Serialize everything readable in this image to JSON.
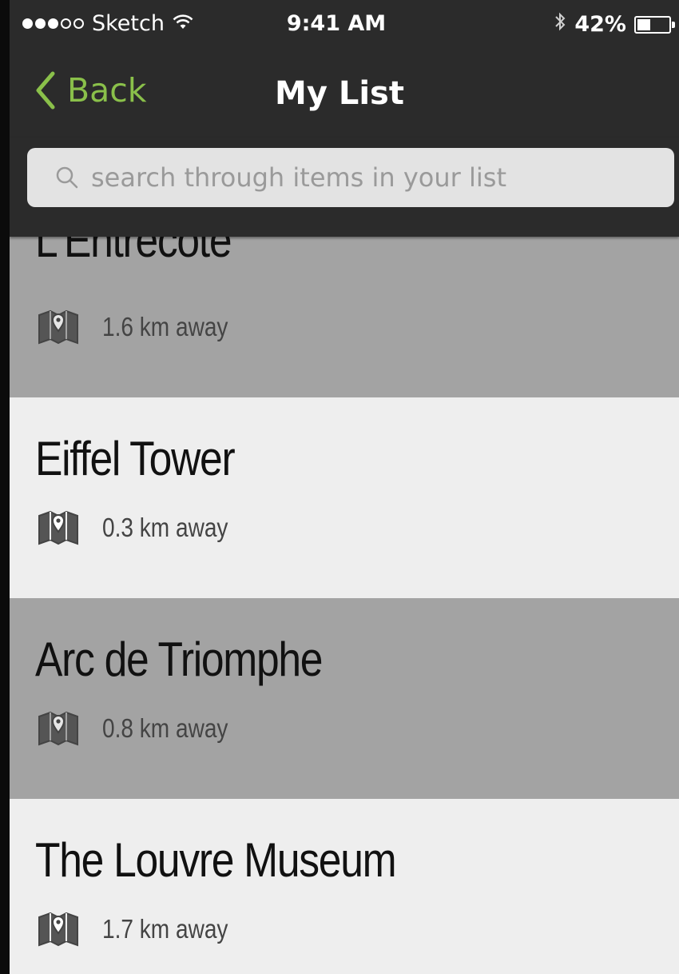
{
  "status_bar": {
    "carrier": "Sketch",
    "time": "9:41 AM",
    "battery_text": "42%",
    "battery_level": 0.42,
    "signal_bars_filled": 3,
    "signal_bars_total": 5,
    "wifi_icon": "wifi-icon",
    "bluetooth_icon": "bluetooth-icon"
  },
  "nav": {
    "back_label": "Back",
    "title": "My List",
    "accent_color": "#8ac04a"
  },
  "search": {
    "placeholder": "search through items in your list",
    "value": ""
  },
  "list": {
    "items": [
      {
        "title": "L'Entrecote",
        "distance": "1.6 km away",
        "icon": "map-pin-icon"
      },
      {
        "title": "Eiffel Tower",
        "distance": "0.3 km away",
        "icon": "map-pin-icon"
      },
      {
        "title": "Arc de Triomphe",
        "distance": "0.8 km away",
        "icon": "map-pin-icon"
      },
      {
        "title": "The Louvre Museum",
        "distance": "1.7 km away",
        "icon": "map-pin-icon"
      }
    ]
  }
}
